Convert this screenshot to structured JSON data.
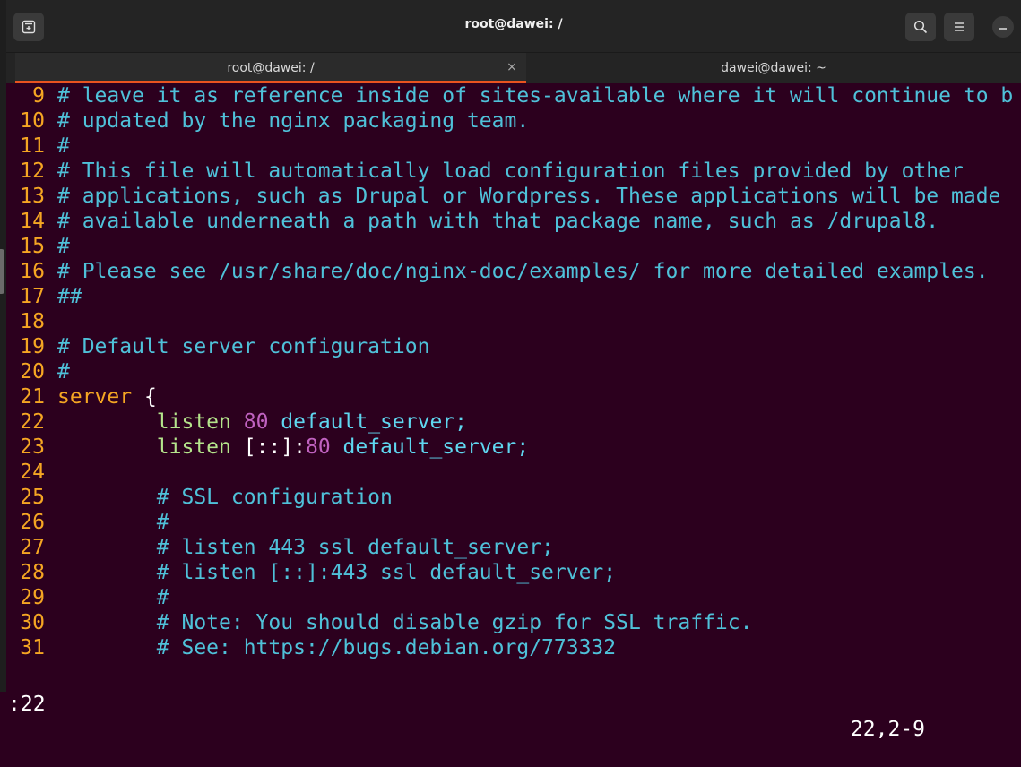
{
  "window": {
    "title": "root@dawei: /"
  },
  "tabs": [
    {
      "label": "root@dawei: /",
      "close": "×"
    },
    {
      "label": "dawei@dawei: ~"
    }
  ],
  "editor": {
    "lines": [
      {
        "n": "9",
        "text": "# leave it as reference inside of sites-available where it will continue to b"
      },
      {
        "n": "10",
        "text": "# updated by the nginx packaging team."
      },
      {
        "n": "11",
        "text": "#"
      },
      {
        "n": "12",
        "text": "# This file will automatically load configuration files provided by other"
      },
      {
        "n": "13",
        "text": "# applications, such as Drupal or Wordpress. These applications will be made"
      },
      {
        "n": "14",
        "text": "# available underneath a path with that package name, such as /drupal8."
      },
      {
        "n": "15",
        "text": "#"
      },
      {
        "n": "16",
        "text": "# Please see /usr/share/doc/nginx-doc/examples/ for more detailed examples."
      },
      {
        "n": "17",
        "text": "##"
      },
      {
        "n": "18",
        "text": ""
      },
      {
        "n": "19",
        "text": "# Default server configuration"
      },
      {
        "n": "20",
        "text": "#"
      },
      {
        "n": "21",
        "kw": "server",
        "rest": " {"
      },
      {
        "n": "22",
        "indent": "        ",
        "dir": "listen",
        "sp1": " ",
        "num": "80",
        "rest": " default_server;"
      },
      {
        "n": "23",
        "indent": "        ",
        "dir": "listen",
        "mid": " [::]:",
        "num": "80",
        "rest": " default_server;"
      },
      {
        "n": "24",
        "text": ""
      },
      {
        "n": "25",
        "indent": "        ",
        "text": "# SSL configuration"
      },
      {
        "n": "26",
        "indent": "        ",
        "text": "#"
      },
      {
        "n": "27",
        "indent": "        ",
        "text": "# listen 443 ssl default_server;"
      },
      {
        "n": "28",
        "indent": "        ",
        "text": "# listen [::]:443 ssl default_server;"
      },
      {
        "n": "29",
        "indent": "        ",
        "text": "#"
      },
      {
        "n": "30",
        "indent": "        ",
        "text": "# Note: You should disable gzip for SSL traffic."
      },
      {
        "n": "31",
        "indent": "        ",
        "text": "# See: https://bugs.debian.org/773332"
      }
    ]
  },
  "status": {
    "command": ":22",
    "position": "22,2-9"
  },
  "icons": {
    "new_tab": "new-tab-icon",
    "search": "search-icon",
    "menu": "hamburger-menu-icon",
    "minimize": "minimize-icon"
  }
}
